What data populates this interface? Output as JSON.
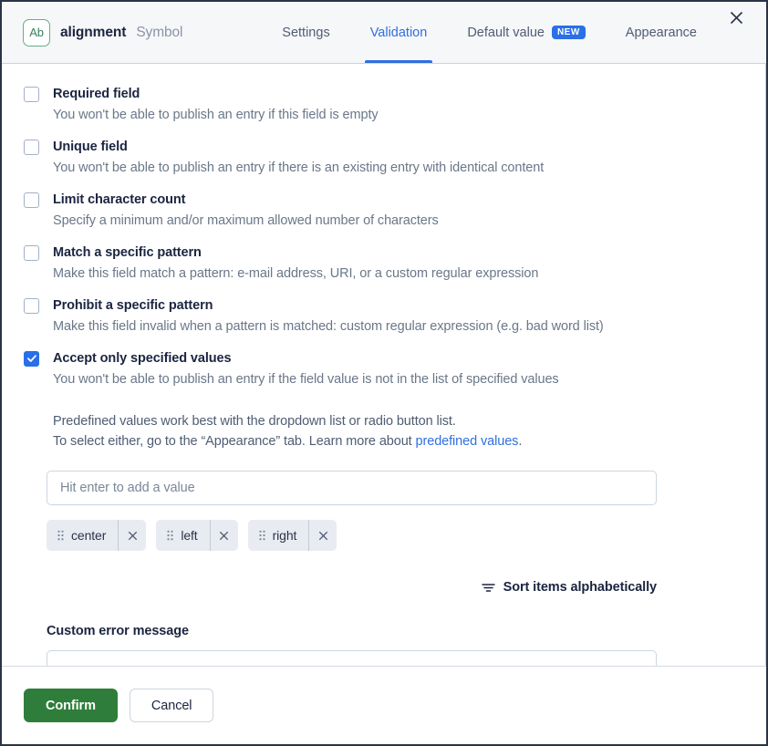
{
  "header": {
    "field_badge": "Ab",
    "field_name": "alignment",
    "field_type": "Symbol",
    "tabs": [
      {
        "label": "Settings",
        "active": false,
        "badge": null
      },
      {
        "label": "Validation",
        "active": true,
        "badge": null
      },
      {
        "label": "Default value",
        "active": false,
        "badge": "NEW"
      },
      {
        "label": "Appearance",
        "active": false,
        "badge": null
      }
    ],
    "close_icon": "close-icon"
  },
  "validations": [
    {
      "title": "Required field",
      "description": "You won't be able to publish an entry if this field is empty",
      "checked": false
    },
    {
      "title": "Unique field",
      "description": "You won't be able to publish an entry if there is an existing entry with identical content",
      "checked": false
    },
    {
      "title": "Limit character count",
      "description": "Specify a minimum and/or maximum allowed number of characters",
      "checked": false
    },
    {
      "title": "Match a specific pattern",
      "description": "Make this field match a pattern: e-mail address, URI, or a custom regular expression",
      "checked": false
    },
    {
      "title": "Prohibit a specific pattern",
      "description": "Make this field invalid when a pattern is matched: custom regular expression (e.g. bad word list)",
      "checked": false
    },
    {
      "title": "Accept only specified values",
      "description": "You won't be able to publish an entry if the field value is not in the list of specified values",
      "checked": true
    }
  ],
  "predefined": {
    "note_line1": "Predefined values work best with the dropdown list or radio button list.",
    "note_line2_before": "To select either, go to the “Appearance” tab. Learn more about ",
    "note_link": "predefined values",
    "note_line2_after": ".",
    "input_placeholder": "Hit enter to add a value",
    "input_value": "",
    "tags": [
      "center",
      "left",
      "right"
    ],
    "remove_icon": "close-icon",
    "drag_icon": "drag-handle-icon",
    "sort_label": "Sort items alphabetically",
    "sort_icon": "sort-icon"
  },
  "custom_error": {
    "label": "Custom error message",
    "value": "",
    "placeholder": ""
  },
  "footer": {
    "confirm_label": "Confirm",
    "cancel_label": "Cancel"
  },
  "colors": {
    "accent_blue": "#2a6fe8",
    "tab_active": "#2f6fe0",
    "confirm_green": "#2f7d3a",
    "badge_green": "#62b183",
    "header_bg": "#f6f7f9",
    "tag_bg": "#e8ebf1"
  }
}
